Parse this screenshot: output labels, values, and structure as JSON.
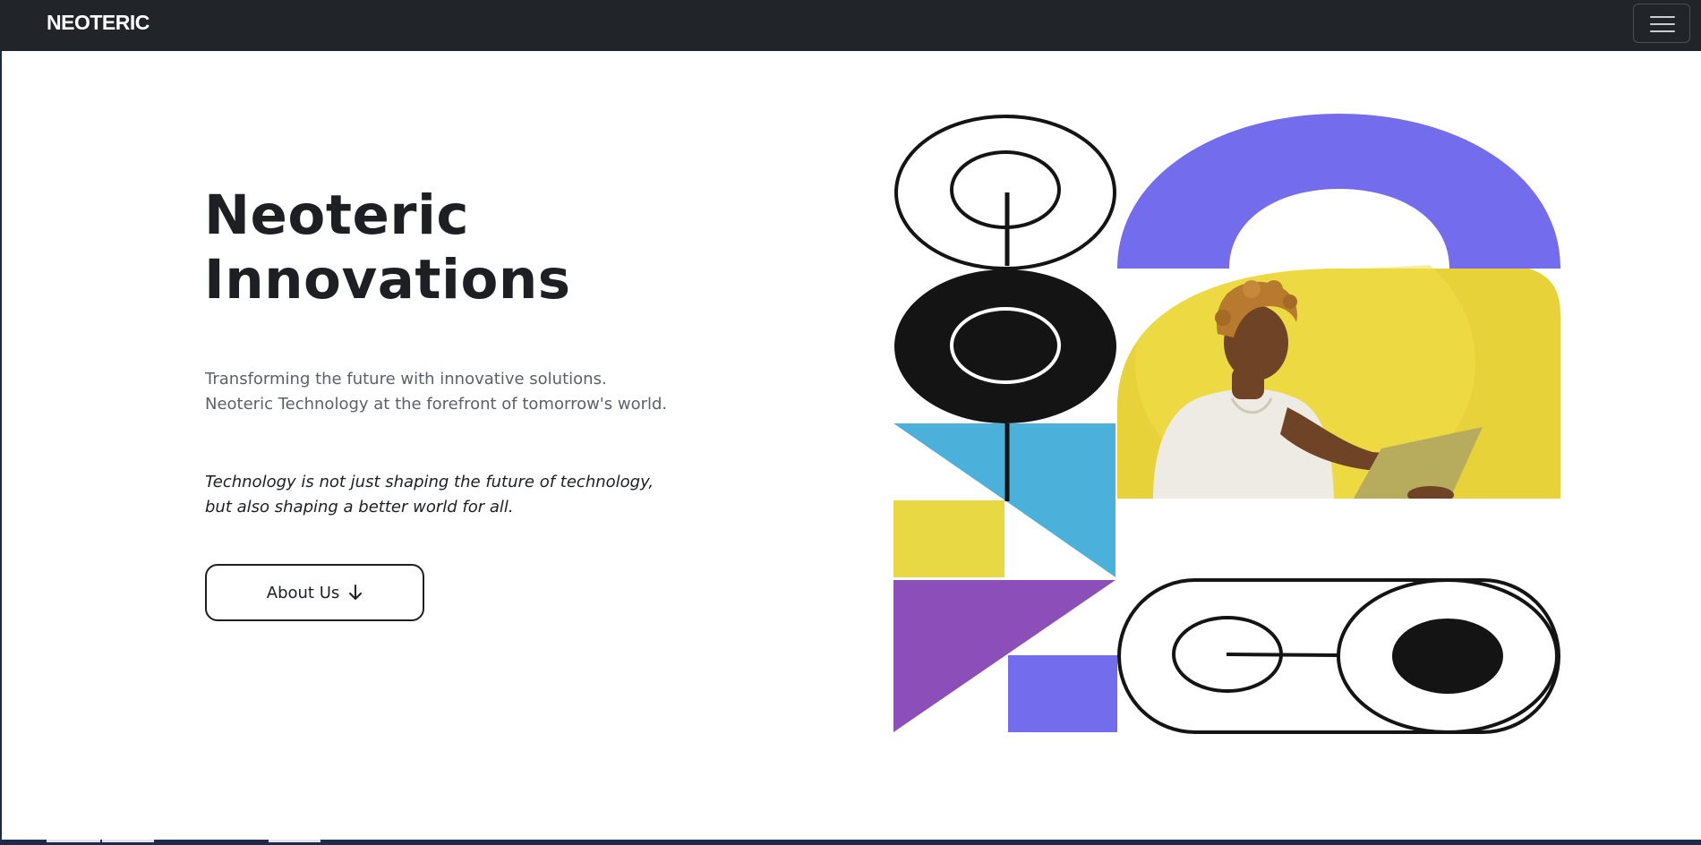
{
  "navbar": {
    "brand": "NEOTERIC",
    "toggler_icon": "hamburger-menu-icon"
  },
  "hero": {
    "title_lines": [
      "Neoteric",
      "Innovations"
    ],
    "subtitle_lines": [
      "Transforming the future with innovative solutions.",
      "Neoteric Technology at the forefront of tomorrow's world."
    ],
    "quote_lines": [
      "Technology is not just shaping the future of technology,",
      "but also shaping a better world for all."
    ],
    "cta_label": "About Us",
    "cta_icon": "arrow-down-icon"
  },
  "illustration": {
    "photo_subject": "person-with-laptop-photo",
    "colors": {
      "indigo": "#736ded",
      "yellow": "#e8d944",
      "sky_blue": "#4bb0da",
      "purple": "#8c4fb9",
      "black": "#141414",
      "navbar": "#212529"
    }
  }
}
